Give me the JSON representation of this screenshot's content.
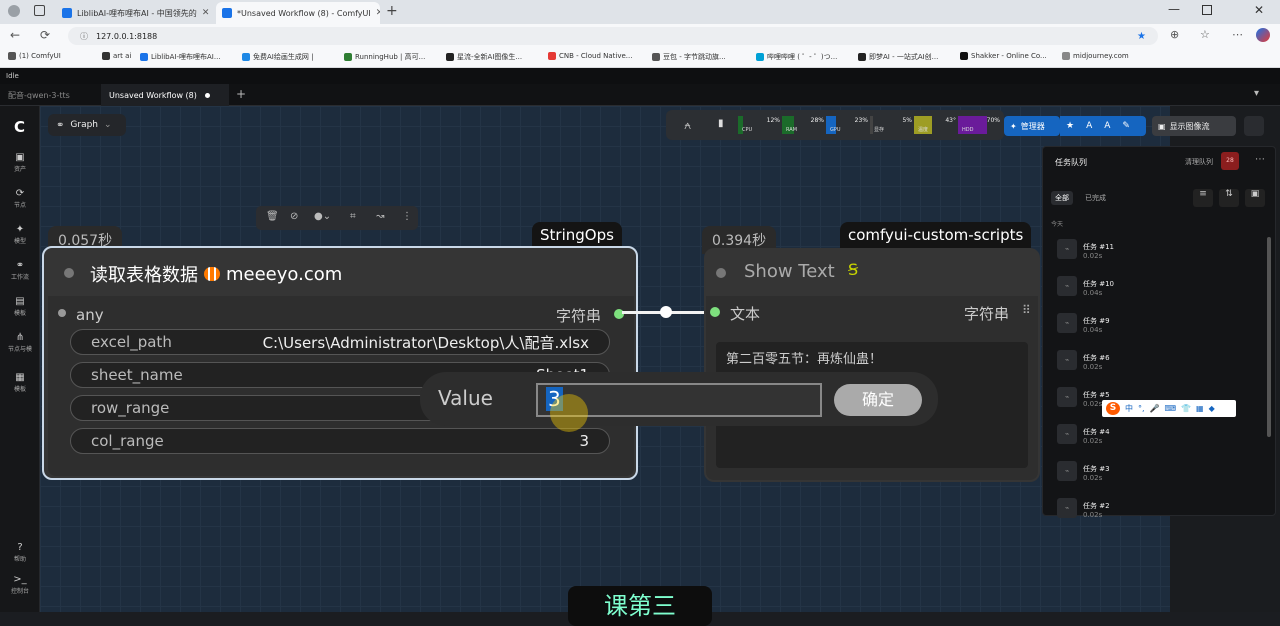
{
  "browser": {
    "tabs": [
      {
        "label": "LiblibAI-哩布哩布AI - 中国领先的",
        "color": "#1a73e8"
      },
      {
        "label": "*Unsaved Workflow (8) - ComfyUI",
        "color": "#1a73e8"
      }
    ],
    "url": "127.0.0.1:8188"
  },
  "bookmarks": [
    {
      "label": "(1) ComfyUI",
      "color": "#555"
    },
    {
      "label": "art ai",
      "color": "#333"
    },
    {
      "label": "LiblibAI-哩布哩布AI...",
      "color": "#1a73e8"
    },
    {
      "label": "免费AI绘画生成网 |",
      "color": "#1e88e5"
    },
    {
      "label": "RunningHub | 高可...",
      "color": "#2e7d32"
    },
    {
      "label": "星流-全新AI图像生...",
      "color": "#222"
    },
    {
      "label": "CNB - Cloud Native...",
      "color": "#e53935"
    },
    {
      "label": "豆包 - 字节跳动旗...",
      "color": "#555"
    },
    {
      "label": "哔哩哔哩 ( ゜- ゜)つ...",
      "color": "#00a1d6"
    },
    {
      "label": "即梦AI - 一站式AI创...",
      "color": "#222"
    },
    {
      "label": "Shakker - Online Co...",
      "color": "#111"
    },
    {
      "label": "midjourney.com",
      "color": "#888"
    }
  ],
  "app": {
    "status": "Idle",
    "tabs": [
      {
        "label": "配音-qwen-3-tts"
      },
      {
        "label": "Unsaved Workflow (8)"
      }
    ]
  },
  "toolbar": {
    "graph_label": "Graph"
  },
  "sidebar": [
    {
      "label": "资产",
      "icon": "image-icon"
    },
    {
      "label": "节点",
      "icon": "node-icon"
    },
    {
      "label": "模型",
      "icon": "model-icon"
    },
    {
      "label": "工作流",
      "icon": "workflow-icon"
    },
    {
      "label": "模板",
      "icon": "template-icon"
    },
    {
      "label": "节点与模",
      "icon": "tree-icon"
    },
    {
      "label": "模板",
      "icon": "grid-icon"
    },
    {
      "label": "帮助",
      "icon": "help-icon"
    },
    {
      "label": "控制台",
      "icon": "terminal-icon"
    }
  ],
  "monitor": {
    "meters": [
      {
        "label": "CPU",
        "value": "12%",
        "color": "#1b6b2a"
      },
      {
        "label": "RAM",
        "value": "28%",
        "color": "#1b6b2a"
      },
      {
        "label": "GPU",
        "value": "23%",
        "color": "#1565c0"
      },
      {
        "label": "显存",
        "value": "5%",
        "color": "#444"
      },
      {
        "label": "温度",
        "value": "43°",
        "color": "#9e9d24"
      },
      {
        "label": "HDD",
        "value": "70%",
        "color": "#6a1b9a"
      }
    ],
    "manager_label": "管理器",
    "show_image_label": "显示图像流"
  },
  "queue": {
    "title": "任务队列",
    "clear_label": "清理队列",
    "count": "28",
    "tabs": [
      "全部",
      "已完成"
    ],
    "section_label": "今天",
    "items": [
      {
        "name": "任务 #11",
        "time": "0.02s"
      },
      {
        "name": "任务 #10",
        "time": "0.04s"
      },
      {
        "name": "任务 #9",
        "time": "0.04s"
      },
      {
        "name": "任务 #6",
        "time": "0.02s"
      },
      {
        "name": "任务 #5",
        "time": "0.02s"
      },
      {
        "name": "任务 #4",
        "time": "0.02s"
      },
      {
        "name": "任务 #3",
        "time": "0.02s"
      },
      {
        "name": "任务 #2",
        "time": "0.02s"
      }
    ]
  },
  "nodes": {
    "read_excel": {
      "time": "0.057秒",
      "badge": "StringOps",
      "title": "读取表格数据",
      "brand": "meeeyo.com",
      "input_label": "any",
      "output_label": "字符串",
      "fields": [
        {
          "name": "excel_path",
          "value": "C:\\Users\\Administrator\\Desktop\\人\\配音.xlsx"
        },
        {
          "name": "sheet_name",
          "value": "Sheet1"
        },
        {
          "name": "row_range",
          "value": ""
        },
        {
          "name": "col_range",
          "value": "3"
        }
      ]
    },
    "show_text": {
      "time": "0.394秒",
      "badge": "comfyui-custom-scripts",
      "title": "Show Text",
      "input_label": "文本",
      "output_label": "字符串",
      "content": "第二百零五节：再炼仙蛊！"
    }
  },
  "value_dialog": {
    "label": "Value",
    "value": "3",
    "confirm": "确定"
  },
  "overlay": {
    "bottom_text": "课第三"
  },
  "ime": {
    "label": "中"
  }
}
